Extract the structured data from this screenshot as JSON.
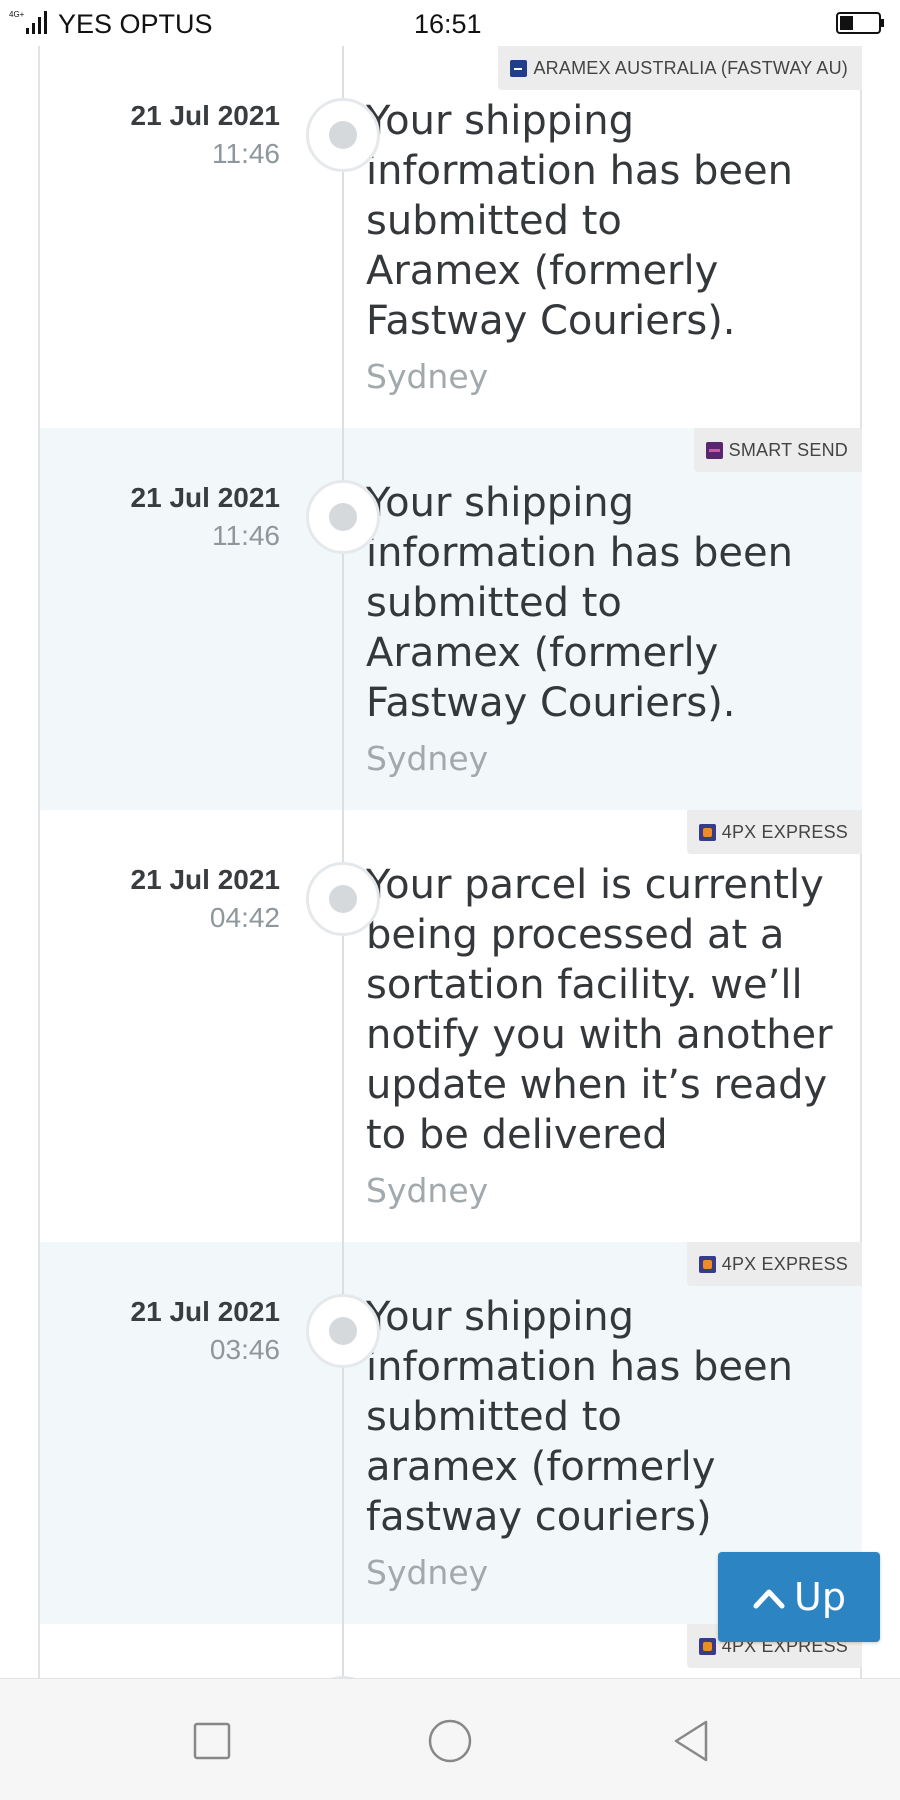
{
  "status_bar": {
    "network": "4G+",
    "carrier": "YES OPTUS",
    "time": "16:51"
  },
  "events": [
    {
      "carrier": "ARAMEX AUSTRALIA (FASTWAY AU)",
      "carrier_icon": "aramex-logo-icon",
      "date": "21 Jul 2021",
      "time": "11:46",
      "message_lines": [
        "Your shipping",
        "information has been",
        "submitted to",
        "Aramex (formerly",
        "Fastway Couriers)."
      ],
      "location": "Sydney"
    },
    {
      "carrier": "SMART SEND",
      "carrier_icon": "smart-send-logo-icon",
      "date": "21 Jul 2021",
      "time": "11:46",
      "message_lines": [
        "Your shipping",
        "information has been",
        "submitted to",
        "Aramex (formerly",
        "Fastway Couriers)."
      ],
      "location": "Sydney"
    },
    {
      "carrier": "4PX EXPRESS",
      "carrier_icon": "4px-logo-icon",
      "date": "21 Jul 2021",
      "time": "04:42",
      "message_lines": [
        "Your parcel is currently",
        "being processed at a",
        "sortation facility. we’ll",
        "notify you with another",
        "update when it’s ready",
        "to be delivered"
      ],
      "location": "Sydney"
    },
    {
      "carrier": "4PX EXPRESS",
      "carrier_icon": "4px-logo-icon",
      "date": "21 Jul 2021",
      "time": "03:46",
      "message_lines": [
        "Your shipping",
        "information has been",
        "submitted to",
        "aramex (formerly",
        "fastway couriers)"
      ],
      "location": "Sydney"
    },
    {
      "carrier": "4PX EXPRESS",
      "carrier_icon": "4px-logo-icon"
    }
  ],
  "up_button": {
    "label": "Up"
  },
  "colors": {
    "accent": "#2c84c3",
    "alt_row_bg": "#f2f7f9",
    "tag_bg": "#ececed"
  }
}
